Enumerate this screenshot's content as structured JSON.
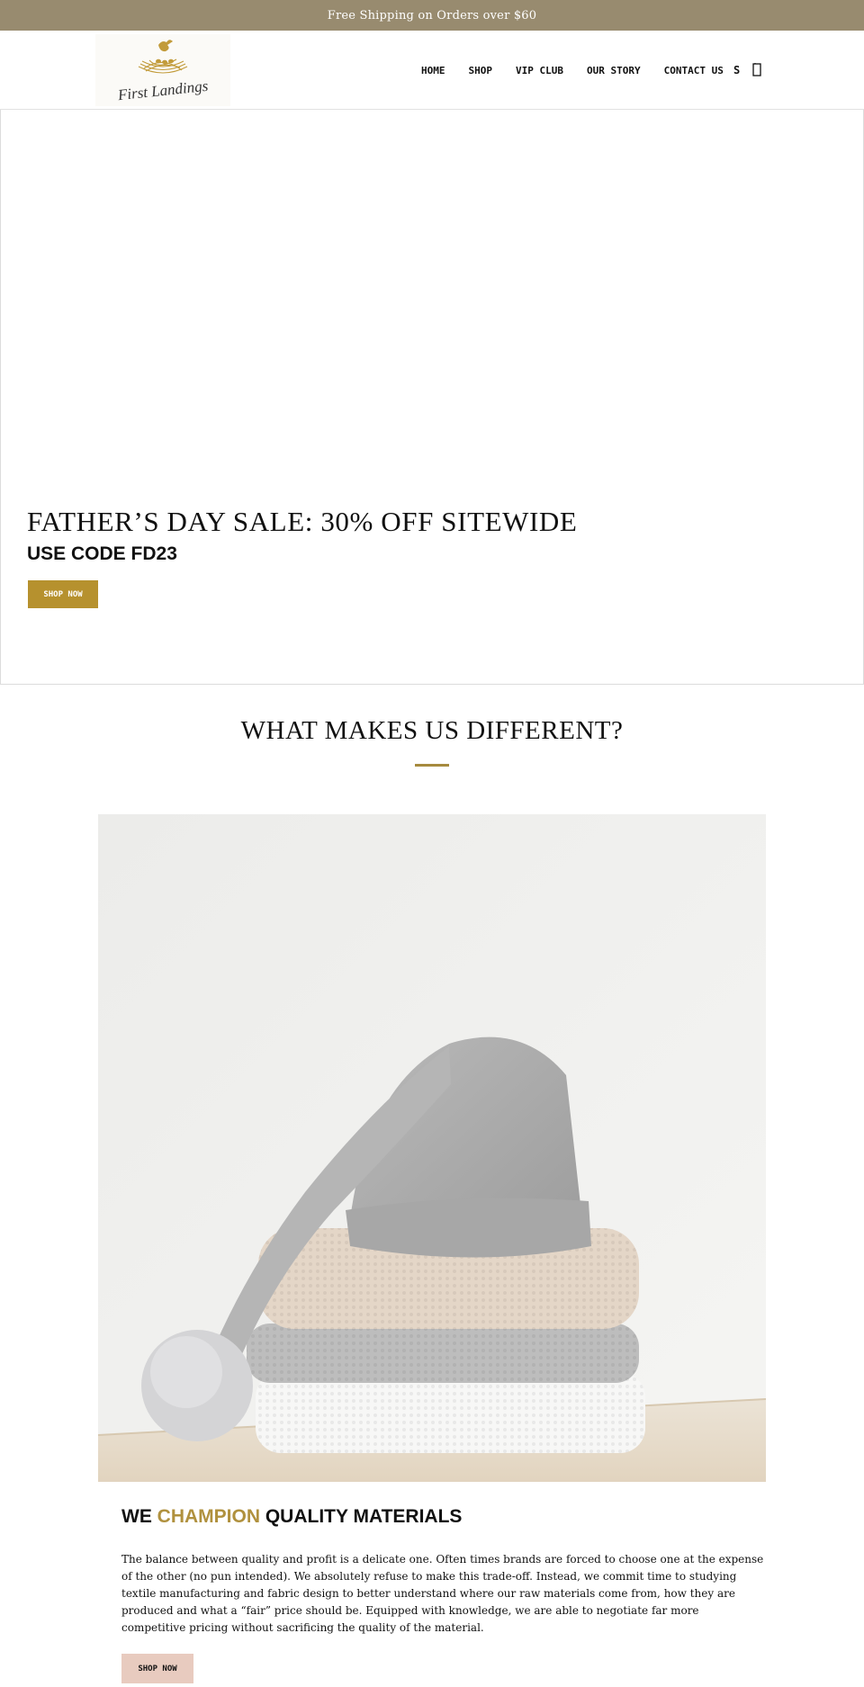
{
  "announcement": {
    "text": "Free Shipping on Orders over $60"
  },
  "header": {
    "logo": {
      "wordmark": "First Landings"
    },
    "nav": [
      {
        "label": "HOME"
      },
      {
        "label": "SHOP"
      },
      {
        "label": "VIP CLUB"
      },
      {
        "label": "OUR STORY"
      },
      {
        "label": "CONTACT US"
      }
    ],
    "search_label": "S",
    "cart_icon": "cart-icon"
  },
  "hero": {
    "title": "FATHER’S DAY SALE: 30% OFF SITEWIDE",
    "subtitle": "USE CODE FD23",
    "button": "SHOP NOW",
    "button_color": "#b6912e"
  },
  "section": {
    "title": "WHAT MAKES US DIFFERENT?",
    "rule_color": "#a68a3e"
  },
  "feature": {
    "heading_pre": "WE ",
    "heading_accent": "CHAMPION",
    "heading_post": " QUALITY MATERIALS",
    "accent_color": "#b0913e",
    "body": "The balance between quality and profit is a delicate one. Often times brands are forced to choose one at the expense of the other (no pun intended). We absolutely refuse to make this trade-off. Instead, we commit time to studying textile manufacturing and fabric design to better understand where our raw materials come from, how they are produced and what a “fair” price should be. Equipped with knowledge, we are able to negotiate far more competitive pricing without sacrificing the quality of the material.",
    "button": "SHOP NOW",
    "button_color": "#e8cbbf"
  },
  "colors": {
    "announcement_bg": "#988b6f",
    "gold": "#b6912e"
  }
}
